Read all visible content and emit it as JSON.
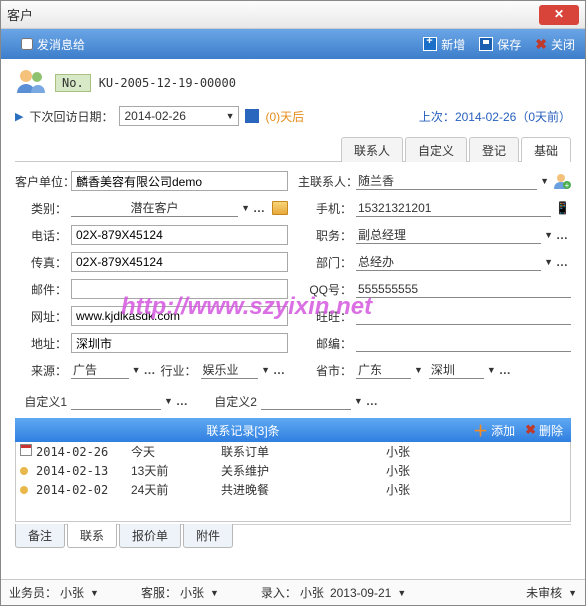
{
  "window": {
    "title": "客户"
  },
  "toolbar": {
    "send_msg": "发消息给",
    "new": "新增",
    "save": "保存",
    "close": "关闭"
  },
  "header": {
    "no_label": "No.",
    "no_value": "KU-2005-12-19-00000",
    "next_visit_label": "下次回访日期：",
    "next_visit_date": "2014-02-26",
    "days_after": "(0)天后",
    "last_label": "上次：",
    "last_value": "2014-02-26（0天前）"
  },
  "tabs": {
    "contact": "联系人",
    "custom": "自定义",
    "register": "登记",
    "basic": "基础"
  },
  "left": {
    "company_lbl": "客户单位：",
    "company": "麟香美容有限公司demo",
    "category_lbl": "类别：",
    "category": "潜在客户",
    "phone_lbl": "电话：",
    "phone": "02X-879X45124",
    "fax_lbl": "传真：",
    "fax": "02X-879X45124",
    "email_lbl": "邮件：",
    "email": "",
    "url_lbl": "网址：",
    "url": "www.kjdlkasdk.com",
    "addr_lbl": "地址：",
    "addr": "深圳市",
    "source_lbl": "来源：",
    "source": "广告",
    "industry_lbl": "行业：",
    "industry": "娱乐业"
  },
  "right": {
    "main_contact_lbl": "主联系人：",
    "main_contact": "随兰香",
    "mobile_lbl": "手机：",
    "mobile": "15321321201",
    "title_lbl": "职务：",
    "title": "副总经理",
    "dept_lbl": "部门：",
    "dept": "总经办",
    "qq_lbl": "QQ号：",
    "qq": "555555555",
    "ww_lbl": "旺旺：",
    "ww": "",
    "zip_lbl": "邮编：",
    "zip": "",
    "prov_lbl": "省市：",
    "prov": "广东",
    "city": "深圳"
  },
  "custom_defs": {
    "c1": "自定义1",
    "c2": "自定义2"
  },
  "grid": {
    "title": "联系记录[3]条",
    "add": "添加",
    "del": "删除",
    "rows": [
      {
        "date": "2014-02-26",
        "rel": "今天",
        "subject": "联系订单",
        "who": "小张",
        "ico": "cal"
      },
      {
        "date": "2014-02-13",
        "rel": "13天前",
        "subject": "关系维护",
        "who": "小张",
        "ico": "dot"
      },
      {
        "date": "2014-02-02",
        "rel": "24天前",
        "subject": "共进晚餐",
        "who": "小张",
        "ico": "dot"
      }
    ]
  },
  "btabs": {
    "note": "备注",
    "contact": "联系",
    "quote": "报价单",
    "attach": "附件"
  },
  "status": {
    "sales_lbl": "业务员：",
    "sales": "小张",
    "cs_lbl": "客服：",
    "cs": "小张",
    "entry_lbl": "录入：",
    "entry": "小张",
    "entry_date": "2013-09-21",
    "review": "未审核"
  },
  "watermark": "http://www.szyixin.net",
  "watermark2": "www.szyixin.net"
}
